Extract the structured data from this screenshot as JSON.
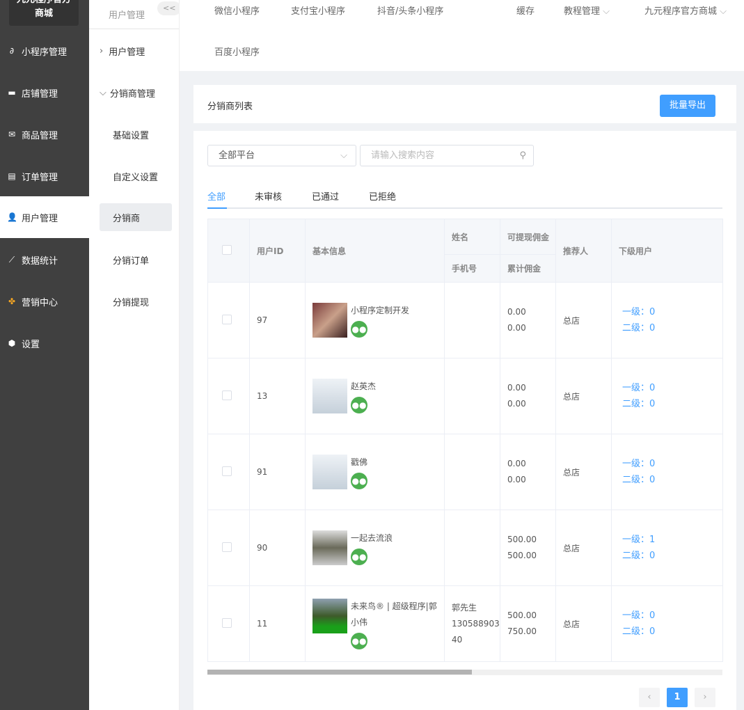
{
  "sidebar": {
    "logo": "九元程序官方商城",
    "items": [
      {
        "label": "小程序管理",
        "icon": "link-icon"
      },
      {
        "label": "店铺管理",
        "icon": "store-icon"
      },
      {
        "label": "商品管理",
        "icon": "goods-icon"
      },
      {
        "label": "订单管理",
        "icon": "order-icon"
      },
      {
        "label": "用户管理",
        "icon": "user-icon"
      },
      {
        "label": "数据统计",
        "icon": "chart-icon"
      },
      {
        "label": "营销中心",
        "icon": "marketing-icon"
      },
      {
        "label": "设置",
        "icon": "gear-icon"
      }
    ]
  },
  "subnav": {
    "title": "用户管理",
    "collapse": "<<",
    "items": [
      "用户管理",
      "分销商管理",
      "基础设置",
      "自定义设置",
      "分销商",
      "分销订单",
      "分销提现"
    ]
  },
  "topnav": {
    "items": [
      "微信小程序",
      "支付宝小程序",
      "抖音/头条小程序",
      "缓存",
      "教程管理",
      "九元程序官方商城",
      "百度小程序"
    ]
  },
  "header": {
    "title": "分销商列表",
    "export": "批量导出"
  },
  "filters": {
    "platform": "全部平台",
    "search_placeholder": "请输入搜索内容"
  },
  "tabs": [
    "全部",
    "未审核",
    "已通过",
    "已拒绝"
  ],
  "table": {
    "headers": {
      "id": "用户ID",
      "info": "基本信息",
      "name": "姓名",
      "phone": "手机号",
      "cash": "可提现佣金",
      "total": "累计佣金",
      "ref": "推荐人",
      "sub": "下级用户"
    },
    "rows": [
      {
        "id": "97",
        "nick": "小程序定制开发",
        "name": "",
        "phone": "",
        "cash": "0.00",
        "total": "0.00",
        "ref": "总店",
        "l1": "一级：0",
        "l2": "二级：0"
      },
      {
        "id": "13",
        "nick": "赵英杰",
        "name": "",
        "phone": "",
        "cash": "0.00",
        "total": "0.00",
        "ref": "总店",
        "l1": "一级：0",
        "l2": "二级：0"
      },
      {
        "id": "91",
        "nick": "戳佛",
        "name": "",
        "phone": "",
        "cash": "0.00",
        "total": "0.00",
        "ref": "总店",
        "l1": "一级：0",
        "l2": "二级：0"
      },
      {
        "id": "90",
        "nick": "一起去流浪",
        "name": "",
        "phone": "",
        "cash": "500.00",
        "total": "500.00",
        "ref": "总店",
        "l1": "一级：1",
        "l2": "二级：0"
      },
      {
        "id": "11",
        "nick": "未来鸟® | 超级程序|郭小伟",
        "name": "郭先生",
        "phone": "13058890340",
        "cash": "500.00",
        "total": "750.00",
        "ref": "总店",
        "l1": "一级：0",
        "l2": "二级：0"
      }
    ]
  },
  "pagination": {
    "current": "1",
    "prev": "‹",
    "next": "›"
  }
}
